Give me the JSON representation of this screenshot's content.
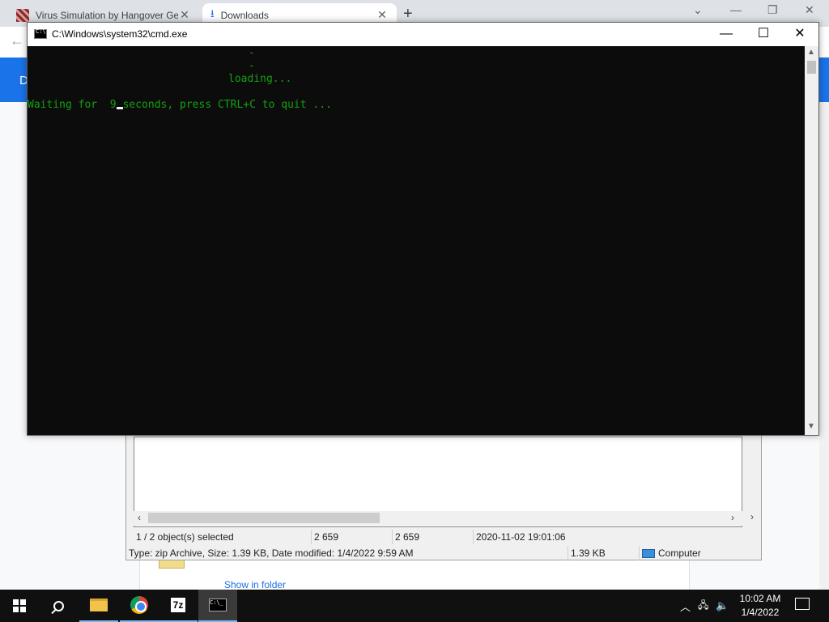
{
  "browser": {
    "tabs": [
      {
        "title": "Virus Simulation by Hangover Ge",
        "close": "✕"
      },
      {
        "title": "Downloads",
        "close": "✕"
      }
    ],
    "new_tab": "+",
    "page_header_letter": "D",
    "show_in_folder": "Show in folder"
  },
  "zip_window": {
    "status_selected": "1 / 2 object(s) selected",
    "status_size1": "2 659",
    "status_size2": "2 659",
    "status_date": "2020-11-02 19:01:06",
    "info_text": "Type: zip Archive, Size: 1.39 KB, Date modified: 1/4/2022 9:59 AM",
    "info_size": "1.39 KB",
    "info_location": "Computer"
  },
  "cmd_window": {
    "title": "C:\\Windows\\system32\\cmd.exe",
    "console_lines": {
      "dash1": "-",
      "dash2": "-",
      "loading": "loading...",
      "wait_prefix": "Waiting for  9",
      "wait_suffix": "seconds, press CTRL+C to quit ..."
    },
    "text_color": "#13a10e",
    "background_color": "#0c0c0c"
  },
  "taskbar": {
    "apps": [
      "start",
      "search",
      "file-explorer",
      "chrome",
      "7-zip",
      "command-prompt"
    ],
    "sevenzip_label": "7z",
    "clock_time": "10:02 AM",
    "clock_date": "1/4/2022"
  }
}
